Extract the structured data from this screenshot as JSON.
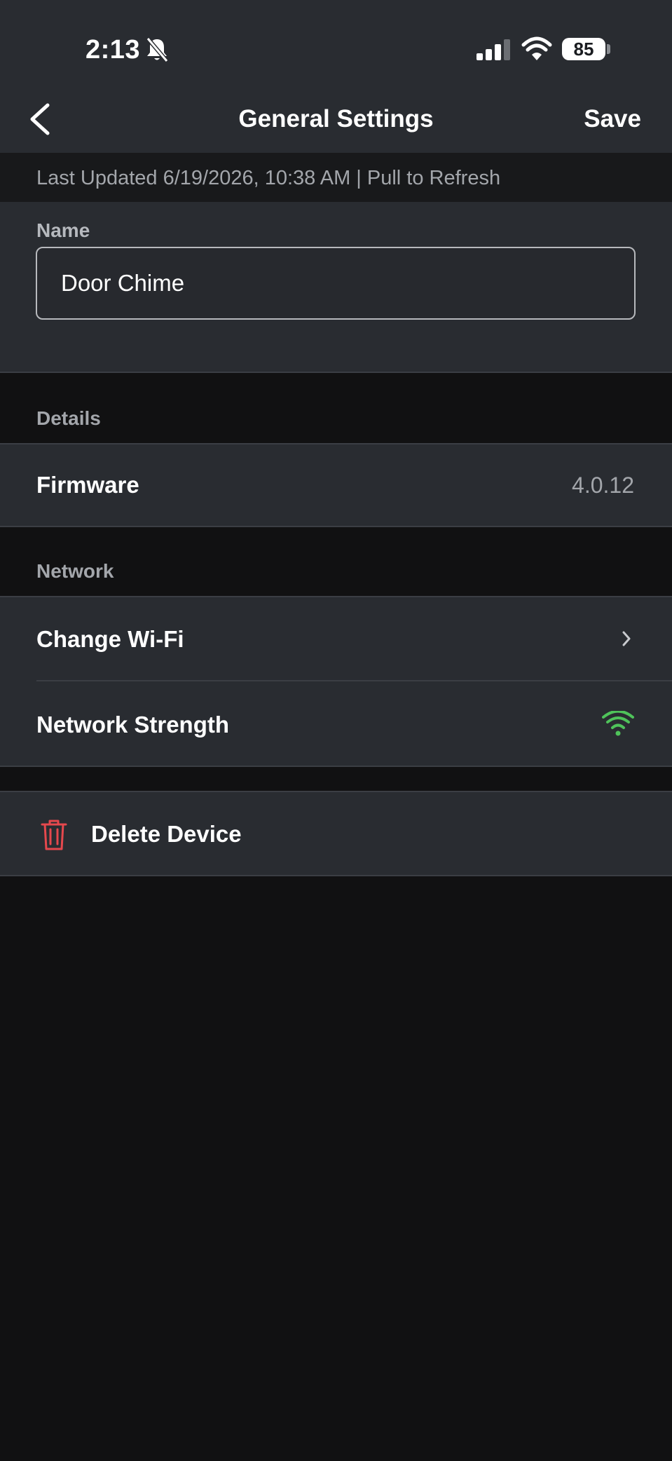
{
  "status_bar": {
    "time": "2:13",
    "battery": "85",
    "icons": [
      "bell-slash-icon",
      "cellular-signal-icon",
      "wifi-icon",
      "battery-icon"
    ]
  },
  "nav": {
    "back_icon": "chevron-left-icon",
    "title": "General Settings",
    "save_label": "Save"
  },
  "last_updated": "Last Updated 6/19/2026, 10:38 AM | Pull to Refresh",
  "name_section": {
    "label": "Name",
    "value": "Door Chime"
  },
  "details": {
    "header": "Details",
    "firmware_label": "Firmware",
    "firmware_value": "4.0.12"
  },
  "network": {
    "header": "Network",
    "change_wifi_label": "Change Wi-Fi",
    "strength_label": "Network Strength",
    "strength_icon": "wifi-strong-icon",
    "strength_color": "#4fc35a"
  },
  "delete": {
    "label": "Delete Device",
    "icon": "trash-icon",
    "icon_color": "#e5484d"
  },
  "colors": {
    "header_bg": "#292c31",
    "page_bg": "#111112",
    "text_muted": "#a3a6ab"
  }
}
